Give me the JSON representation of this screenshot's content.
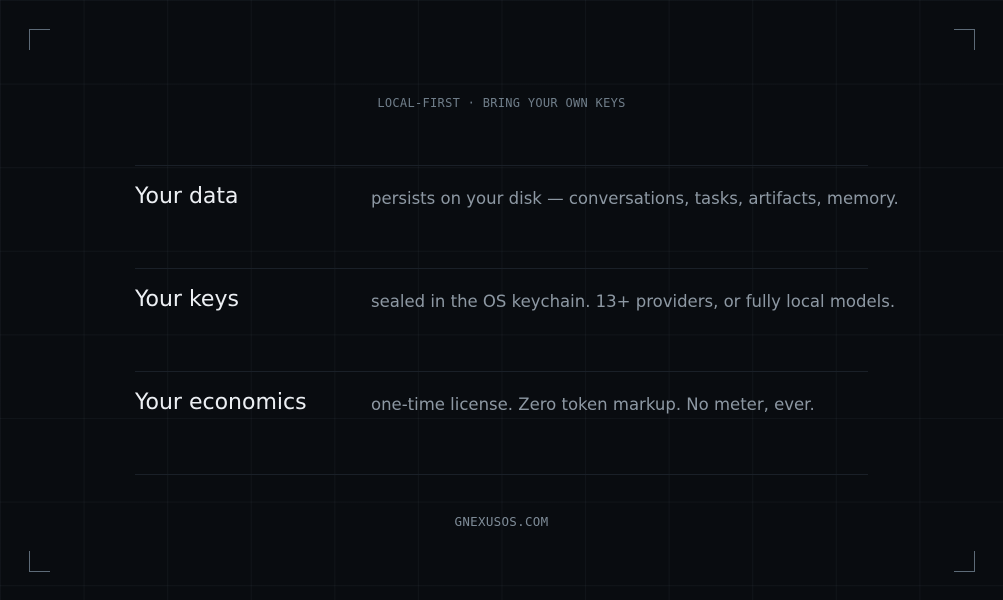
{
  "eyebrow": "LOCAL-FIRST · BRING YOUR OWN KEYS",
  "rows": [
    {
      "title": "Your data",
      "description": "persists on your disk — conversations, tasks, artifacts, memory."
    },
    {
      "title": "Your keys",
      "description": "sealed in the OS keychain. 13+ providers, or fully local models."
    },
    {
      "title": "Your economics",
      "description": "one-time license. Zero token markup. No meter, ever."
    }
  ],
  "footer": "GNEXUSOS.COM"
}
